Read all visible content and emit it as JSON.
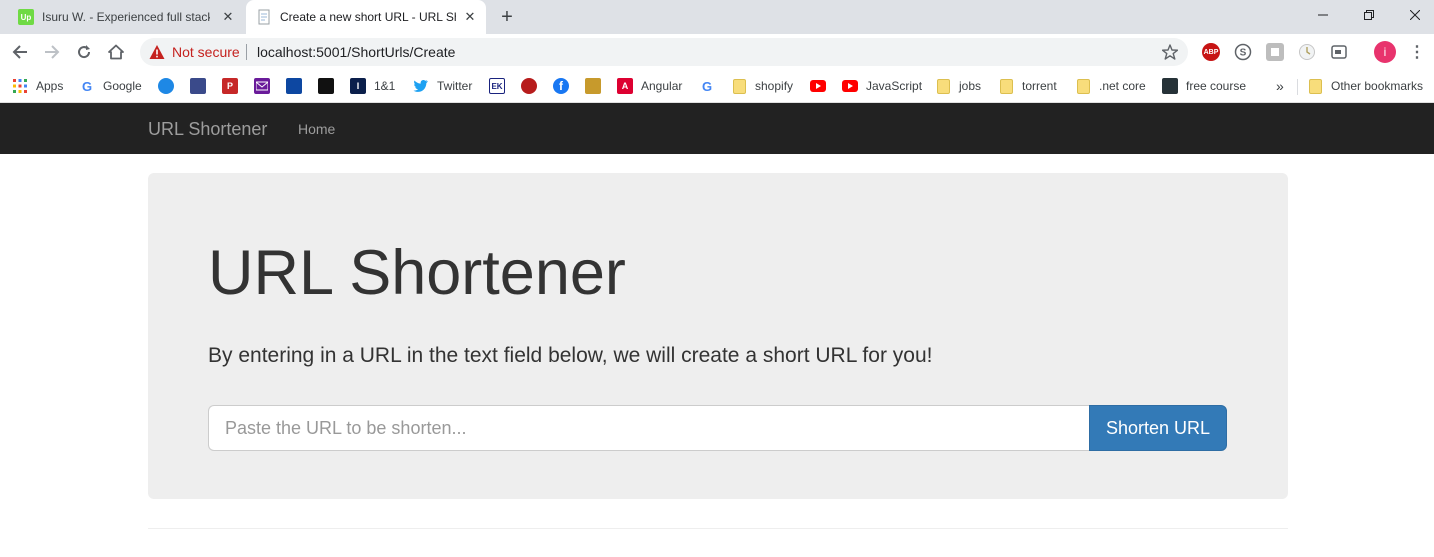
{
  "browser": {
    "tabs": [
      {
        "title": "Isuru W. - Experienced full stack d",
        "favicon": "upwork-icon",
        "favicon_text": "Up",
        "active": false
      },
      {
        "title": "Create a new short URL - URL Sh",
        "favicon": "page-icon",
        "active": true
      }
    ],
    "address": {
      "security_label": "Not secure",
      "url": "localhost:5001/ShortUrls/Create"
    },
    "extensions": [
      "adblock-plus-icon",
      "skype-icon",
      "extension-icon",
      "clock-icon",
      "cast-icon"
    ],
    "extension_labels": {
      "abp": "ABP"
    },
    "profile_initial": "i",
    "bookmarks": [
      {
        "label": "Apps",
        "icon": "apps-grid-icon"
      },
      {
        "label": "Google",
        "icon": "google-icon",
        "icon_text": "G"
      },
      {
        "label": "",
        "icon": "globe-icon"
      },
      {
        "label": "",
        "icon": "bookmark-favicon"
      },
      {
        "label": "",
        "icon": "bookmark-favicon",
        "icon_text": "P"
      },
      {
        "label": "",
        "icon": "mail-icon"
      },
      {
        "label": "",
        "icon": "bookmark-favicon"
      },
      {
        "label": "",
        "icon": "bookmark-favicon"
      },
      {
        "label": "1&1",
        "icon": "bookmark-favicon",
        "icon_text": "I"
      },
      {
        "label": "Twitter",
        "icon": "twitter-icon"
      },
      {
        "label": "",
        "icon": "bookmark-favicon",
        "icon_text": "EK"
      },
      {
        "label": "",
        "icon": "bookmark-favicon"
      },
      {
        "label": "",
        "icon": "facebook-icon",
        "icon_text": "f"
      },
      {
        "label": "",
        "icon": "bookmark-favicon"
      },
      {
        "label": "Angular",
        "icon": "angular-icon",
        "icon_text": "A"
      },
      {
        "label": "",
        "icon": "google-icon",
        "icon_text": "G"
      },
      {
        "label": "shopify",
        "icon": "folder-icon"
      },
      {
        "label": "",
        "icon": "youtube-icon"
      },
      {
        "label": "JavaScript",
        "icon": "youtube-icon"
      },
      {
        "label": "jobs",
        "icon": "folder-icon"
      },
      {
        "label": "torrent",
        "icon": "folder-icon"
      },
      {
        "label": ".net core",
        "icon": "folder-icon"
      },
      {
        "label": "free course",
        "icon": "bookmark-favicon"
      }
    ],
    "bookmarks_overflow": "»",
    "other_bookmarks": "Other bookmarks"
  },
  "page": {
    "navbar": {
      "brand": "URL Shortener",
      "links": [
        "Home"
      ]
    },
    "jumbotron": {
      "title": "URL Shortener",
      "lead": "By entering in a URL in the text field below, we will create a short URL for you!",
      "input_placeholder": "Paste the URL to be shorten...",
      "input_value": "",
      "button_label": "Shorten URL"
    }
  },
  "colors": {
    "navbar_bg": "#222222",
    "jumbotron_bg": "#eeeeee",
    "primary_button": "#337ab7",
    "not_secure_red": "#c5221f"
  }
}
